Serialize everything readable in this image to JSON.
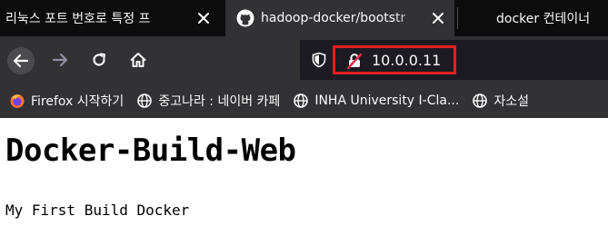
{
  "tabs": [
    {
      "label": "리눅스 포트 번호로 특정 프",
      "icon": "page-icon",
      "active": false
    },
    {
      "label": "hadoop-docker/bootstr",
      "icon": "github-icon",
      "active": true
    },
    {
      "label": "docker 컨테이너",
      "icon": "page-icon",
      "active": false
    }
  ],
  "urlbar": {
    "url": "10.0.0.11",
    "security_icon": "insecure-lock-icon"
  },
  "bookmarks": [
    {
      "label": "Firefox 시작하기",
      "icon": "firefox-icon"
    },
    {
      "label": "중고나라 : 네이버 카페",
      "icon": "globe-icon"
    },
    {
      "label": "INHA University I-Cla...",
      "icon": "globe-icon"
    },
    {
      "label": "자소설",
      "icon": "globe-icon"
    }
  ],
  "page": {
    "heading": "Docker-Build-Web",
    "text": "My First Build Docker"
  },
  "colors": {
    "tabstrip": "#0c0c0d",
    "toolbar": "#323234",
    "urlbar": "#1c1b22",
    "highlight": "#e02020"
  }
}
